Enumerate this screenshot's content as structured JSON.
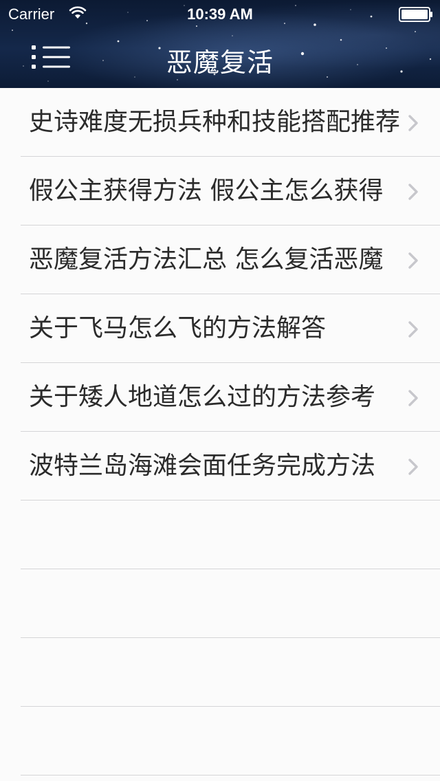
{
  "status_bar": {
    "carrier": "Carrier",
    "time": "10:39 AM"
  },
  "nav_bar": {
    "title": "恶魔复活",
    "menu_icon": "list-menu-icon"
  },
  "list": {
    "items": [
      {
        "label": "史诗难度无损兵种和技能搭配推荐"
      },
      {
        "label": "假公主获得方法 假公主怎么获得"
      },
      {
        "label": "恶魔复活方法汇总 怎么复活恶魔"
      },
      {
        "label": "关于飞马怎么飞的方法解答"
      },
      {
        "label": "关于矮人地道怎么过的方法参考"
      },
      {
        "label": "波特兰岛海滩会面任务完成方法"
      },
      {
        "label": ""
      },
      {
        "label": ""
      },
      {
        "label": ""
      },
      {
        "label": ""
      }
    ],
    "disclosure_icon": "chevron-right-icon"
  },
  "colors": {
    "header_bg": "#14284a",
    "list_bg": "#fbfbfb",
    "text": "#2b2b2b",
    "separator": "#d5d5d7",
    "chevron": "#c7c7cc"
  }
}
